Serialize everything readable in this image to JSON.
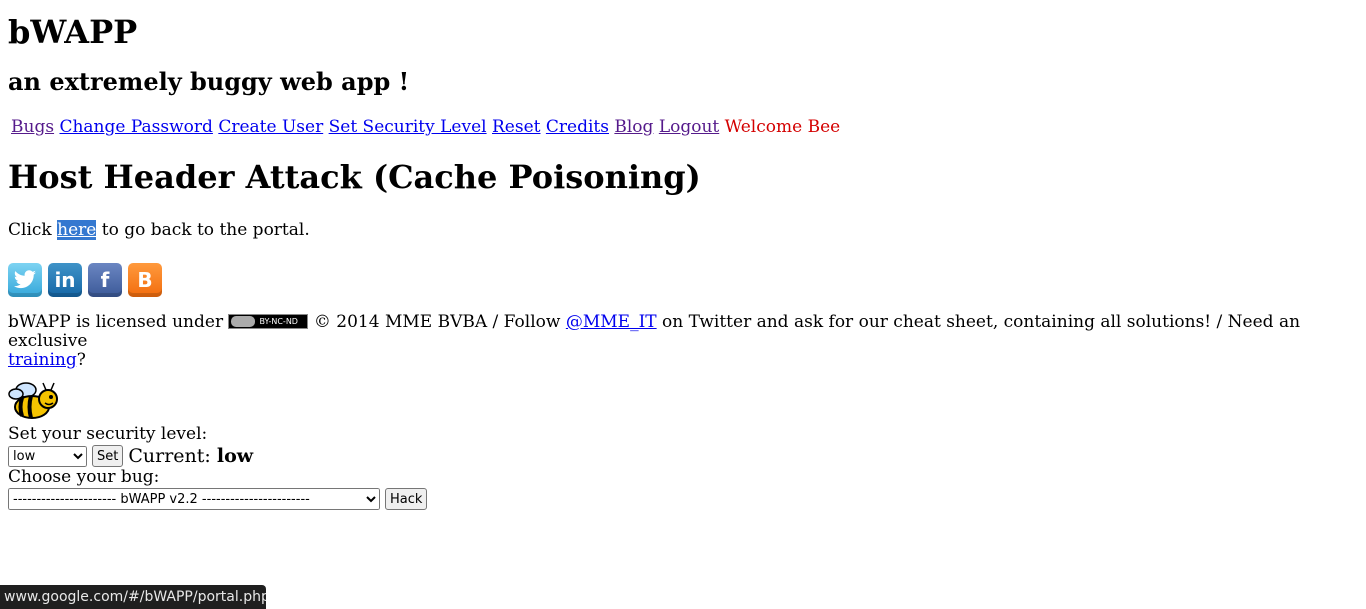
{
  "header": {
    "title": "bWAPP",
    "subtitle": "an extremely buggy web app !"
  },
  "menu": {
    "items": [
      "Bugs",
      "Change Password",
      "Create User",
      "Set Security Level",
      "Reset",
      "Credits",
      "Blog",
      "Logout"
    ],
    "welcome": "Welcome Bee"
  },
  "main": {
    "title": "Host Header Attack (Cache Poisoning)",
    "back_prefix": "Click",
    "back_link": "here",
    "back_suffix": "to go back to the portal."
  },
  "social": {
    "icons": [
      "twitter-icon",
      "linkedin-icon",
      "facebook-icon",
      "blogger-icon"
    ]
  },
  "footer": {
    "license_prefix": "bWAPP is licensed under",
    "cc_badge": "BY-NC-ND",
    "license_middle": "© 2014 MME BVBA / Follow",
    "twitter_link": "@MME_IT",
    "license_suffix": "on Twitter and ask for our cheat sheet, containing all solutions! / Need an exclusive",
    "training_link": "training",
    "question_mark": "?"
  },
  "security": {
    "label": "Set your security level:",
    "selected": "low",
    "set_button": "Set",
    "current_label": "Current:",
    "current_value": "low",
    "bug_label": "Choose your bug:",
    "bug_selected": "---------------------- bWAPP v2.2 -----------------------",
    "hack_button": "Hack"
  },
  "statusbar": {
    "url": "www.google.com/#/bWAPP/portal.php"
  }
}
